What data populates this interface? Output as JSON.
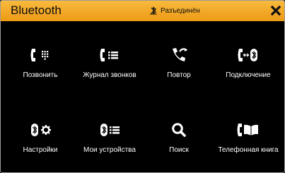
{
  "title": "Bluetooth",
  "status": {
    "text": "Разъединён",
    "icon": "bluetooth-disconnected-icon"
  },
  "close_icon": "close-icon",
  "tiles": [
    {
      "label": "Позвонить",
      "icon": "dial-icon"
    },
    {
      "label": "Журнал звонков",
      "icon": "call-log-icon"
    },
    {
      "label": "Повтор",
      "icon": "redial-icon"
    },
    {
      "label": "Подключение",
      "icon": "connect-icon"
    },
    {
      "label": "Настройки",
      "icon": "bluetooth-settings-icon"
    },
    {
      "label": "Мои устройства",
      "icon": "my-devices-icon"
    },
    {
      "label": "Поиск",
      "icon": "search-icon"
    },
    {
      "label": "Телефонная книга",
      "icon": "phonebook-icon"
    }
  ],
  "colors": {
    "titlebar": "#f2a726",
    "background": "#000000",
    "text": "#ffffff"
  }
}
